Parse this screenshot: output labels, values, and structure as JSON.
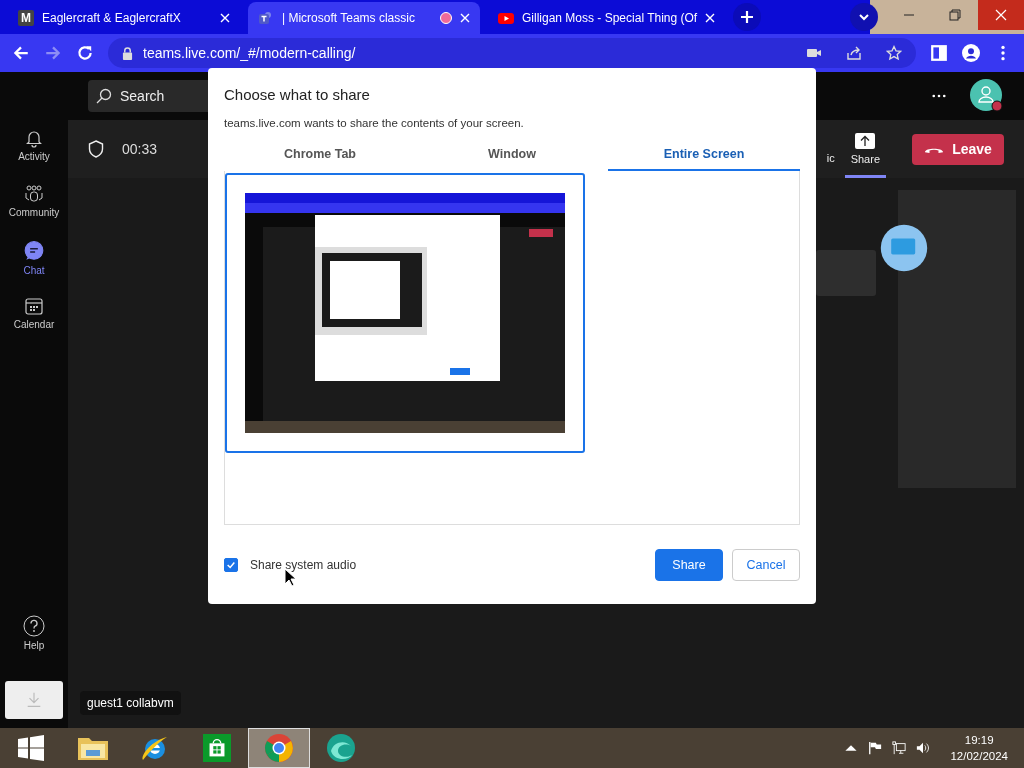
{
  "browser": {
    "tabs": [
      {
        "kind": "letter",
        "badge": "M",
        "title": "Eaglercraft & EaglercraftX",
        "selected": false,
        "recording": false
      },
      {
        "kind": "teams",
        "title": "| Microsoft Teams classic",
        "selected": true,
        "recording": true
      },
      {
        "kind": "youtube",
        "title": "Gilligan Moss - Special Thing (Of",
        "selected": false,
        "recording": false
      }
    ],
    "url": "teams.live.com/_#/modern-calling/"
  },
  "teams": {
    "search": {
      "placeholder": "Search"
    },
    "rail": [
      {
        "kind": "bell",
        "label": "Activity",
        "selected": false
      },
      {
        "kind": "people",
        "label": "Community",
        "selected": false
      },
      {
        "kind": "chat",
        "label": "Chat",
        "selected": true
      },
      {
        "kind": "calendar",
        "label": "Calendar",
        "selected": false
      }
    ],
    "help": "Help",
    "tooltip": "guest1 collabvm",
    "meeting": {
      "timer": "00:33",
      "controls": [
        {
          "kind": "mic",
          "label": "ic",
          "selected": false
        },
        {
          "kind": "share",
          "label": "Share",
          "selected": true
        }
      ],
      "leave": "Leave"
    }
  },
  "dialog": {
    "title": "Choose what to share",
    "message": "teams.live.com wants to share the contents of your screen.",
    "tabs": [
      {
        "label": "Chrome Tab",
        "selected": false
      },
      {
        "label": "Window",
        "selected": false
      },
      {
        "label": "Entire Screen",
        "selected": true
      }
    ],
    "screens": [
      {
        "selected": true
      }
    ],
    "share_audio": {
      "label": "Share system audio",
      "checked": true
    },
    "buttons": [
      {
        "label": "Share",
        "kind": "primary"
      },
      {
        "label": "Cancel",
        "kind": "secondary"
      }
    ]
  },
  "taskbar": {
    "apps": [
      {
        "kind": "start",
        "selected": false
      },
      {
        "kind": "folder",
        "selected": false
      },
      {
        "kind": "ie",
        "selected": false
      },
      {
        "kind": "store",
        "selected": false
      },
      {
        "kind": "chrome",
        "selected": true
      },
      {
        "kind": "swirl",
        "selected": false
      }
    ],
    "time": "19:19",
    "date": "12/02/2024"
  }
}
